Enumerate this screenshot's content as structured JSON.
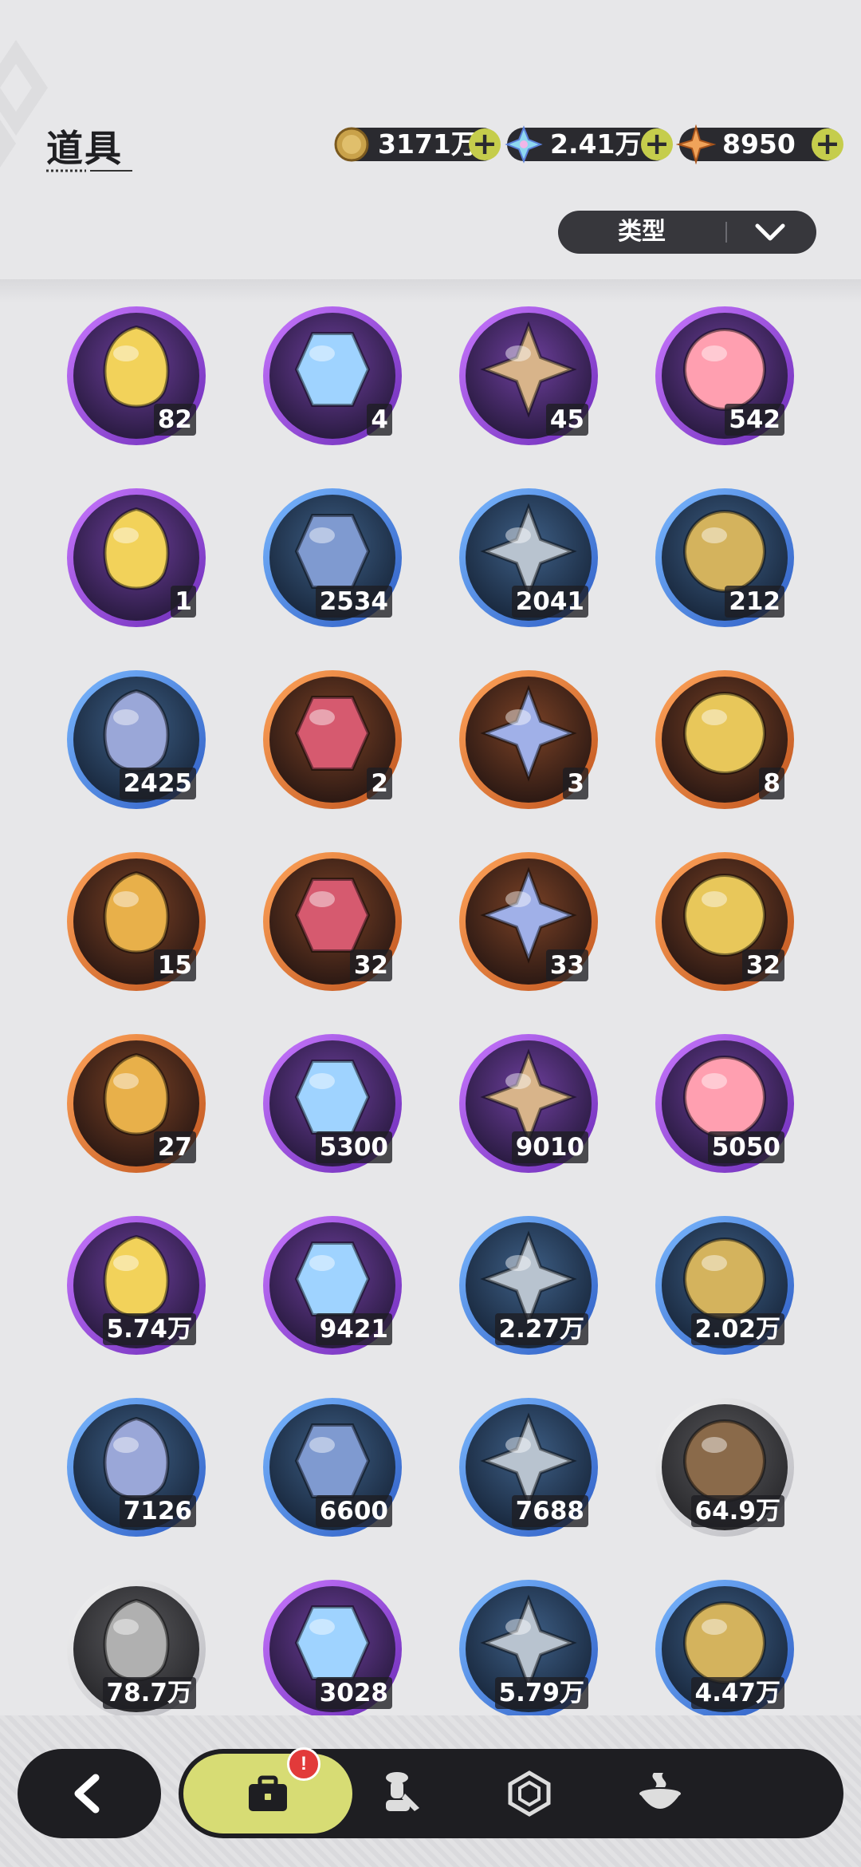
{
  "header": {
    "title": "道具"
  },
  "currencies": [
    {
      "name": "gold-coin",
      "value": "3171万",
      "icon": "coin-icon"
    },
    {
      "name": "crystal",
      "value": "2.41万",
      "icon": "crystal-icon"
    },
    {
      "name": "star-gem",
      "value": "8950",
      "icon": "star-gem-icon"
    }
  ],
  "filter": {
    "label": "类型"
  },
  "items": [
    {
      "icon": "golden-egg-icon",
      "count": "82",
      "rarity": "purple"
    },
    {
      "icon": "magic-mirror-icon",
      "count": "4",
      "rarity": "purple"
    },
    {
      "icon": "scroll-icon",
      "count": "45",
      "rarity": "purple"
    },
    {
      "icon": "peach-icon",
      "count": "542",
      "rarity": "purple"
    },
    {
      "icon": "card-book-icon",
      "count": "1",
      "rarity": "purple"
    },
    {
      "icon": "shovel-icon",
      "count": "2534",
      "rarity": "blue"
    },
    {
      "icon": "boxing-glove-icon",
      "count": "2041",
      "rarity": "blue"
    },
    {
      "icon": "pickaxe-icon",
      "count": "212",
      "rarity": "blue"
    },
    {
      "icon": "hammer-icon",
      "count": "2425",
      "rarity": "blue"
    },
    {
      "icon": "spiked-ball-icon",
      "count": "2",
      "rarity": "orange"
    },
    {
      "icon": "drill-icon",
      "count": "3",
      "rarity": "orange"
    },
    {
      "icon": "golden-key-icon",
      "count": "8",
      "rarity": "orange"
    },
    {
      "icon": "emblem-badge-icon",
      "count": "15",
      "rarity": "orange"
    },
    {
      "icon": "pink-gem-icon",
      "count": "32",
      "rarity": "orange"
    },
    {
      "icon": "outfit-coin-icon",
      "count": "33",
      "rarity": "orange"
    },
    {
      "icon": "wheel-ticket-icon",
      "count": "32",
      "rarity": "orange"
    },
    {
      "icon": "puzzle-ticket-icon",
      "count": "27",
      "rarity": "orange"
    },
    {
      "icon": "trophy-medal-icon",
      "count": "5300",
      "rarity": "purple"
    },
    {
      "icon": "moon-star-icon",
      "count": "9010",
      "rarity": "purple"
    },
    {
      "icon": "fist-coin-icon",
      "count": "5050",
      "rarity": "purple"
    },
    {
      "icon": "blue-token-icon",
      "count": "5.74万",
      "rarity": "purple"
    },
    {
      "icon": "heart-coin-icon",
      "count": "9421",
      "rarity": "purple"
    },
    {
      "icon": "silver-coin-icon",
      "count": "2.27万",
      "rarity": "blue"
    },
    {
      "icon": "blade-icon",
      "count": "2.02万",
      "rarity": "blue"
    },
    {
      "icon": "scale-shield-icon",
      "count": "7126",
      "rarity": "blue"
    },
    {
      "icon": "gear-coin-icon",
      "count": "6600",
      "rarity": "blue"
    },
    {
      "icon": "leaf-icon",
      "count": "7688",
      "rarity": "blue"
    },
    {
      "icon": "wood-logs-icon",
      "count": "64.9万",
      "rarity": "gray"
    },
    {
      "icon": "stone-bricks-icon",
      "count": "78.7万",
      "rarity": "gray"
    },
    {
      "icon": "gold-crystal-icon",
      "count": "3028",
      "rarity": "purple"
    },
    {
      "icon": "gold-sand-icon",
      "count": "5.79万",
      "rarity": "blue"
    },
    {
      "icon": "red-crystal-icon",
      "count": "4.47万",
      "rarity": "blue"
    }
  ],
  "nav": {
    "items": [
      {
        "icon": "briefcase-icon",
        "active": true,
        "badge": "!"
      },
      {
        "icon": "hero-pawn-icon"
      },
      {
        "icon": "hexagon-gem-icon"
      },
      {
        "icon": "cauldron-icon"
      }
    ]
  }
}
